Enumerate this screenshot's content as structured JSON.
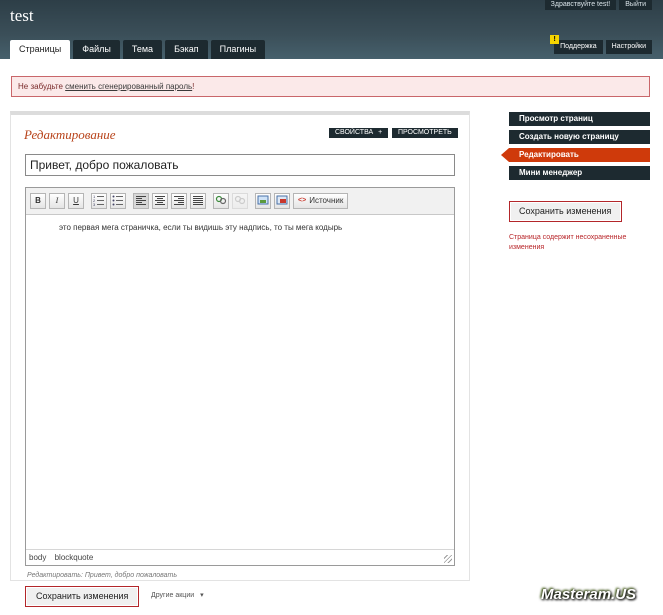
{
  "site": {
    "title": "test"
  },
  "top_links": [
    "Здравствуйте test!",
    "Выйти"
  ],
  "tabs": [
    "Страницы",
    "Файлы",
    "Тема",
    "Бэкап",
    "Плагины"
  ],
  "right_tabs": {
    "support": "Поддержка",
    "settings": "Настройки",
    "warn_badge": "!"
  },
  "notice": {
    "prefix": "Не забудьте ",
    "link": "сменить сгенерированный пароль",
    "suffix": "!"
  },
  "editor": {
    "heading": "Редактирование",
    "properties_button": "СВОЙСТВА",
    "properties_icon": "+",
    "preview_button": "ПРОСМОТРЕТЬ",
    "page_title_value": "Привет, добро пожаловать",
    "toolbar": {
      "bold": "B",
      "italic": "I",
      "underline": "U",
      "source_label": "Источник",
      "source_icon": "<>"
    },
    "body_text": "это  первая мега страничка, если ты видишь эту надпись, то ты мега кодырь",
    "status_path": [
      "body",
      "blockquote"
    ],
    "hint": "Редактировать: Привет, добро пожаловать",
    "save_button": "Сохранить изменения",
    "other_actions": "Другие акции",
    "other_actions_arrow": "▾"
  },
  "sidebar": {
    "items": [
      "Просмотр страниц",
      "Создать новую страницу",
      "Редактировать",
      "Мини менеджер"
    ],
    "active_index": 2,
    "save_button": "Сохранить изменения",
    "unsaved_note": "Страница содержит несохраненные изменения"
  },
  "watermark": "Masteram.US",
  "colors": {
    "header": "#3b4f59",
    "accent": "#cf3a0b",
    "dark_button": "#1d2a30",
    "notice_border": "#c9666a"
  }
}
